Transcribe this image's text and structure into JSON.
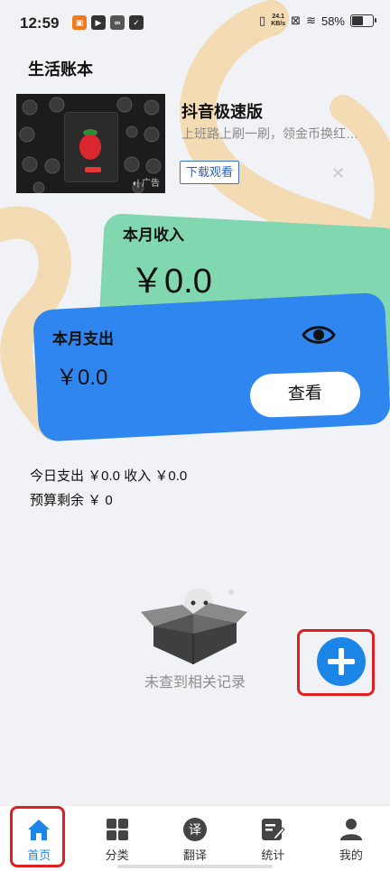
{
  "status_bar": {
    "time": "12:59",
    "net_speed_value": "24.1",
    "net_speed_unit": "KB/s",
    "battery_percent": "58%",
    "battery_level": 0.58
  },
  "page": {
    "title": "生活账本"
  },
  "ad": {
    "title": "抖音极速版",
    "description": "上班路上刷一刷，领金币换红…",
    "button_label": "下载观看",
    "tag": "广告",
    "close_label": "✕"
  },
  "income": {
    "label": "本月收入",
    "value": "￥0.0"
  },
  "expense": {
    "label": "本月支出",
    "value": "￥0.0",
    "view_button": "查看"
  },
  "summary": {
    "today_line": "今日支出 ￥0.0  收入 ￥0.0",
    "budget_line": "预算剩余 ￥ 0"
  },
  "empty": {
    "text": "未查到相关记录"
  },
  "tabs": [
    {
      "label": "首页",
      "icon": "home-icon",
      "active": true
    },
    {
      "label": "分类",
      "icon": "grid-icon"
    },
    {
      "label": "翻译",
      "icon": "translate-icon"
    },
    {
      "label": "统计",
      "icon": "edit-chart-icon"
    },
    {
      "label": "我的",
      "icon": "person-icon"
    }
  ],
  "colors": {
    "accent": "#1c86e8",
    "income_card": "#80d7b0",
    "expense_card": "#2f86ee",
    "highlight": "#e02020"
  }
}
